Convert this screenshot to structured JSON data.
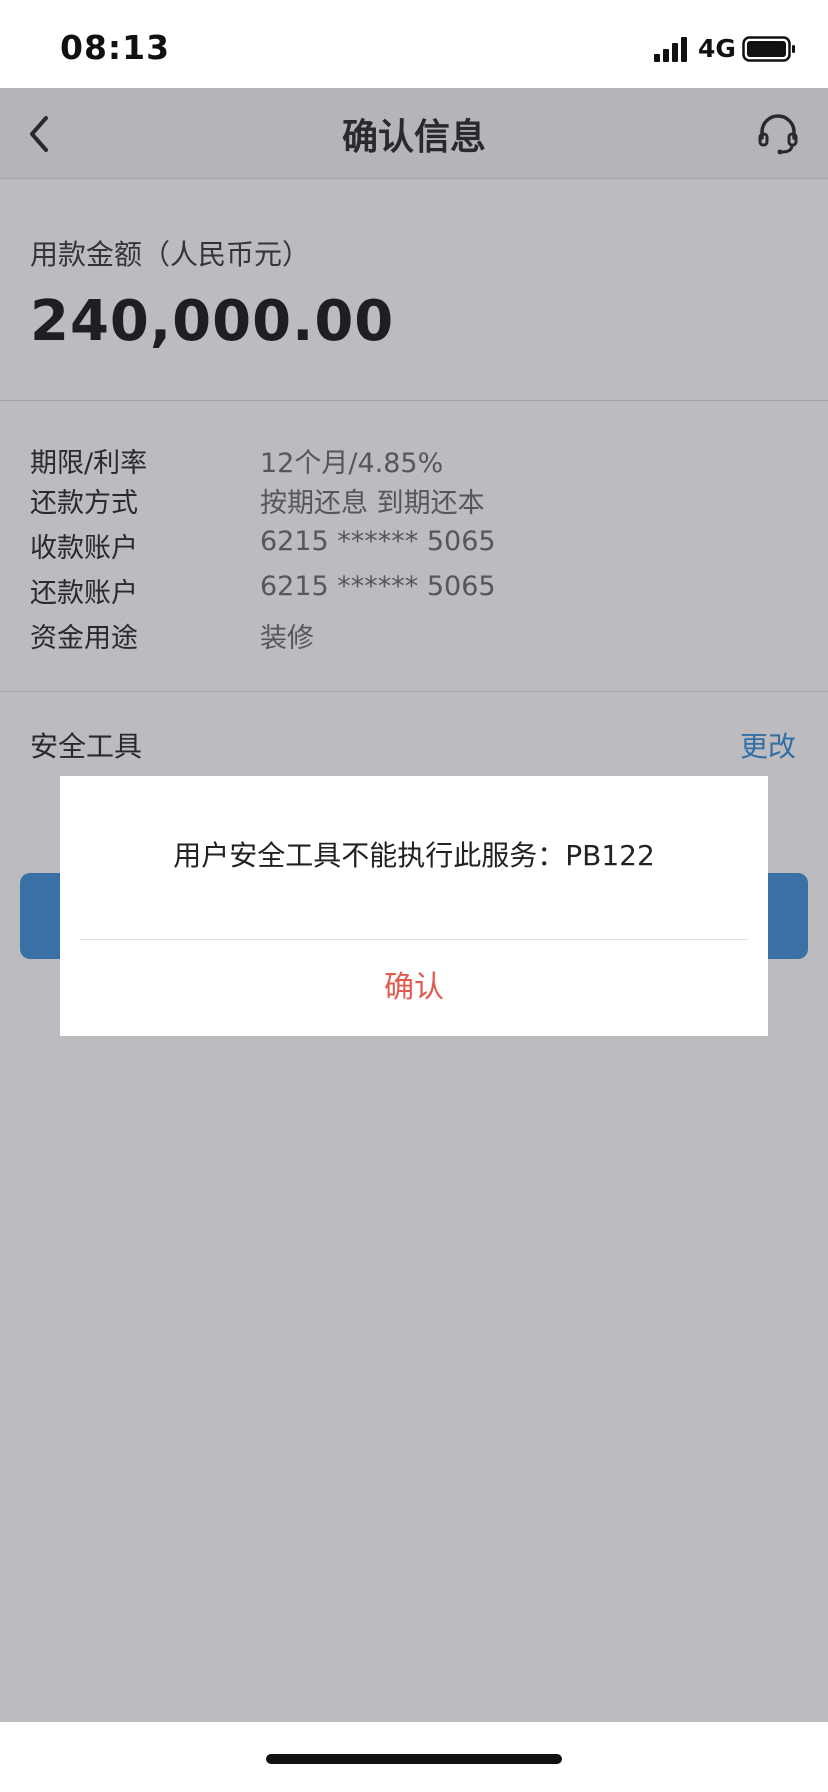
{
  "status_bar": {
    "time": "08:13",
    "network": "4G"
  },
  "header": {
    "title": "确认信息",
    "back_icon": "chevron-left-icon",
    "support_icon": "headset-icon"
  },
  "loan": {
    "amount_label": "用款金额（人民币元）",
    "amount_value": "240,000.00"
  },
  "details": [
    {
      "label": "期限/利率",
      "value": "12个月/4.85%"
    },
    {
      "label": "还款方式",
      "value": "按期还息 到期还本"
    },
    {
      "label": "收款账户",
      "value": "6215 ****** 5065"
    },
    {
      "label": "还款账户",
      "value": "6215 ****** 5065"
    },
    {
      "label": "资金用途",
      "value": "装修"
    }
  ],
  "security": {
    "label": "安全工具",
    "change_label": "更改"
  },
  "modal": {
    "message": "用户安全工具不能执行此服务：PB122",
    "confirm_label": "确认"
  },
  "colors": {
    "accent": "#3a8fd8",
    "link": "#2f8cd6",
    "confirm": "#e05a4e",
    "overlay": "rgba(55,55,70,0.34)"
  }
}
